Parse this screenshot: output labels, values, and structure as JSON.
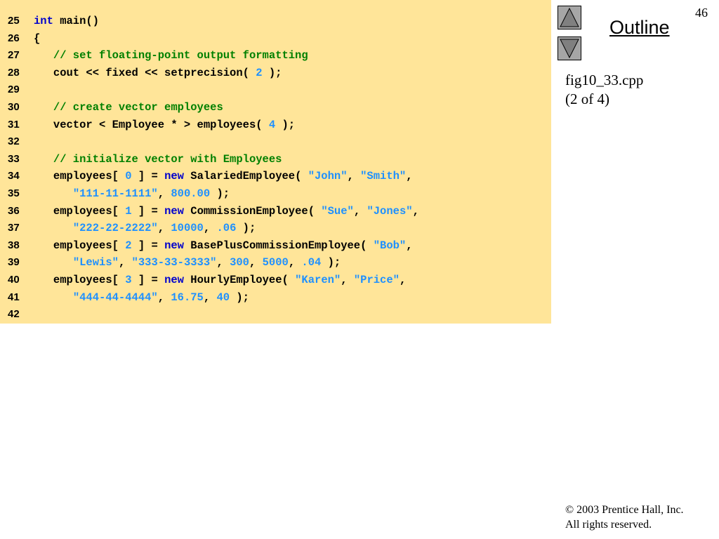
{
  "page_number": "46",
  "nav": {
    "outline_label": "Outline",
    "up_icon": "triangle-up-icon",
    "down_icon": "triangle-down-icon"
  },
  "file": {
    "name": "fig10_33.cpp",
    "part": "(2 of 4)"
  },
  "footer": {
    "copyright": "© 2003 Prentice Hall, Inc.",
    "rights": "All rights reserved."
  },
  "colors": {
    "panel": "#FFE599",
    "keyword": "#0000CC",
    "literal": "#1E90FF",
    "comment": "#008000"
  },
  "code_lines": [
    {
      "num": "25",
      "tokens": [
        [
          "kw",
          "int"
        ],
        [
          "plain",
          " main()"
        ]
      ]
    },
    {
      "num": "26",
      "tokens": [
        [
          "plain",
          "{"
        ]
      ]
    },
    {
      "num": "27",
      "tokens": [
        [
          "com",
          "   // set floating-point output formatting"
        ]
      ]
    },
    {
      "num": "28",
      "tokens": [
        [
          "plain",
          "   cout << fixed << setprecision( "
        ],
        [
          "num",
          "2"
        ],
        [
          "plain",
          " );"
        ]
      ]
    },
    {
      "num": "29",
      "tokens": []
    },
    {
      "num": "30",
      "tokens": [
        [
          "com",
          "   // create vector employees"
        ]
      ]
    },
    {
      "num": "31",
      "tokens": [
        [
          "plain",
          "   vector < Employee * > employees( "
        ],
        [
          "num",
          "4"
        ],
        [
          "plain",
          " );"
        ]
      ]
    },
    {
      "num": "32",
      "tokens": []
    },
    {
      "num": "33",
      "tokens": [
        [
          "com",
          "   // initialize vector with Employees"
        ]
      ]
    },
    {
      "num": "34",
      "tokens": [
        [
          "plain",
          "   employees[ "
        ],
        [
          "num",
          "0"
        ],
        [
          "plain",
          " ] = "
        ],
        [
          "kw",
          "new"
        ],
        [
          "plain",
          " SalariedEmployee( "
        ],
        [
          "str",
          "\"John\""
        ],
        [
          "plain",
          ", "
        ],
        [
          "str",
          "\"Smith\""
        ],
        [
          "plain",
          ","
        ]
      ]
    },
    {
      "num": "35",
      "tokens": [
        [
          "plain",
          "      "
        ],
        [
          "str",
          "\"111-11-1111\""
        ],
        [
          "plain",
          ", "
        ],
        [
          "num",
          "800.00"
        ],
        [
          "plain",
          " );"
        ]
      ]
    },
    {
      "num": "36",
      "tokens": [
        [
          "plain",
          "   employees[ "
        ],
        [
          "num",
          "1"
        ],
        [
          "plain",
          " ] = "
        ],
        [
          "kw",
          "new"
        ],
        [
          "plain",
          " CommissionEmployee( "
        ],
        [
          "str",
          "\"Sue\""
        ],
        [
          "plain",
          ", "
        ],
        [
          "str",
          "\"Jones\""
        ],
        [
          "plain",
          ","
        ]
      ]
    },
    {
      "num": "37",
      "tokens": [
        [
          "plain",
          "      "
        ],
        [
          "str",
          "\"222-22-2222\""
        ],
        [
          "plain",
          ", "
        ],
        [
          "num",
          "10000"
        ],
        [
          "plain",
          ", "
        ],
        [
          "num",
          ".06"
        ],
        [
          "plain",
          " );"
        ]
      ]
    },
    {
      "num": "38",
      "tokens": [
        [
          "plain",
          "   employees[ "
        ],
        [
          "num",
          "2"
        ],
        [
          "plain",
          " ] = "
        ],
        [
          "kw",
          "new"
        ],
        [
          "plain",
          " BasePlusCommissionEmployee( "
        ],
        [
          "str",
          "\"Bob\""
        ],
        [
          "plain",
          ","
        ]
      ]
    },
    {
      "num": "39",
      "tokens": [
        [
          "plain",
          "      "
        ],
        [
          "str",
          "\"Lewis\""
        ],
        [
          "plain",
          ", "
        ],
        [
          "str",
          "\"333-33-3333\""
        ],
        [
          "plain",
          ", "
        ],
        [
          "num",
          "300"
        ],
        [
          "plain",
          ", "
        ],
        [
          "num",
          "5000"
        ],
        [
          "plain",
          ", "
        ],
        [
          "num",
          ".04"
        ],
        [
          "plain",
          " );"
        ]
      ]
    },
    {
      "num": "40",
      "tokens": [
        [
          "plain",
          "   employees[ "
        ],
        [
          "num",
          "3"
        ],
        [
          "plain",
          " ] = "
        ],
        [
          "kw",
          "new"
        ],
        [
          "plain",
          " HourlyEmployee( "
        ],
        [
          "str",
          "\"Karen\""
        ],
        [
          "plain",
          ", "
        ],
        [
          "str",
          "\"Price\""
        ],
        [
          "plain",
          ","
        ]
      ]
    },
    {
      "num": "41",
      "tokens": [
        [
          "plain",
          "      "
        ],
        [
          "str",
          "\"444-44-4444\""
        ],
        [
          "plain",
          ", "
        ],
        [
          "num",
          "16.75"
        ],
        [
          "plain",
          ", "
        ],
        [
          "num",
          "40"
        ],
        [
          "plain",
          " );"
        ]
      ]
    },
    {
      "num": "42",
      "tokens": []
    }
  ]
}
